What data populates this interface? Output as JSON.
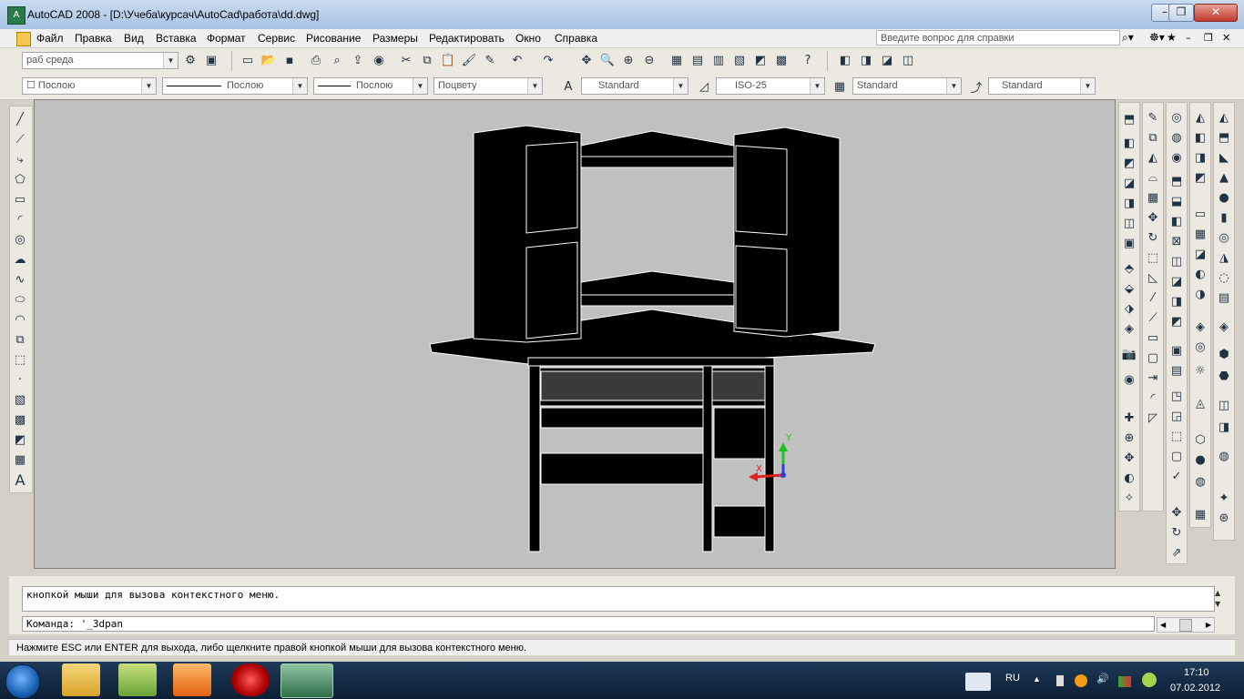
{
  "window": {
    "title": "AutoCAD 2008 - [D:\\Учеба\\курсач\\AutoCad\\работа\\dd.dwg]",
    "app_icon": "autocad-icon",
    "controls": [
      "minimize-icon",
      "restore-icon",
      "close-icon"
    ]
  },
  "menu": {
    "items": [
      "Файл",
      "Правка",
      "Вид",
      "Вставка",
      "Формат",
      "Сервис",
      "Рисование",
      "Размеры",
      "Редактировать",
      "Окно",
      "Справка"
    ],
    "help_placeholder": "Введите вопрос для справки"
  },
  "toolbar1": {
    "workspace": "раб среда"
  },
  "toolbar2": {
    "layer": "Послою",
    "linetype": "Послою",
    "lineweight": "Послою",
    "plotstyle": "Поцвету",
    "textstyle": "Standard",
    "dimstyle": "ISO-25",
    "tablestyle": "Standard",
    "mleaderstyle": "Standard"
  },
  "ucs": {
    "x_label": "X",
    "y_label": "Y"
  },
  "command": {
    "history": "кнопкой мыши для вызова контекстного меню.",
    "prompt": "Команда: '_3dpan"
  },
  "status": {
    "text": "Нажмите ESC или ENTER для выхода, либо щелкните правой кнопкой мыши для вызова контекстного меню."
  },
  "taskbar": {
    "lang": "RU",
    "time": "17:10",
    "date": "07.02.2012"
  },
  "colors": {
    "viewport_bg": "#c0c0c0",
    "model_fill": "#000000",
    "model_edges": "#ffffff",
    "axis_x": "#e02020",
    "axis_y": "#20c020",
    "axis_z": "#2040e0"
  }
}
